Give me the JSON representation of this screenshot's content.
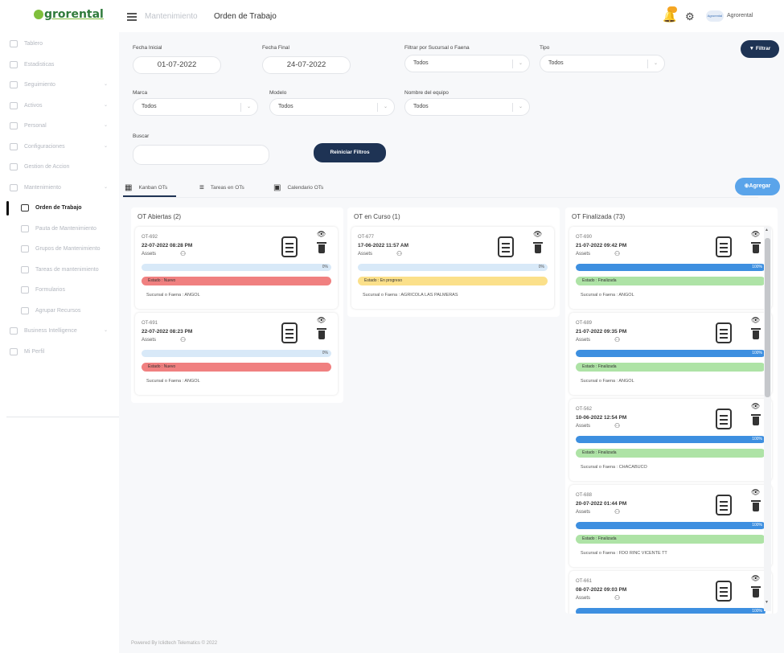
{
  "app": {
    "logo_text": "grorental"
  },
  "sidebar": {
    "items": [
      {
        "label": "Tablero",
        "chevron": false,
        "sub": false,
        "active": false
      },
      {
        "label": "Estadisticas",
        "chevron": false,
        "sub": false,
        "active": false
      },
      {
        "label": "Seguimiento",
        "chevron": true,
        "sub": false,
        "active": false
      },
      {
        "label": "Activos",
        "chevron": true,
        "sub": false,
        "active": false
      },
      {
        "label": "Personal",
        "chevron": true,
        "sub": false,
        "active": false
      },
      {
        "label": "Configuraciones",
        "chevron": true,
        "sub": false,
        "active": false
      },
      {
        "label": "Gestion de Accion",
        "chevron": false,
        "sub": false,
        "active": false
      },
      {
        "label": "Mantenimiento",
        "chevron": true,
        "sub": false,
        "active": false
      },
      {
        "label": "Orden de Trabajo",
        "chevron": false,
        "sub": true,
        "active": true
      },
      {
        "label": "Pauta de Mantenimiento",
        "chevron": false,
        "sub": true,
        "active": false
      },
      {
        "label": "Grupos de Mantenimiento",
        "chevron": false,
        "sub": true,
        "active": false
      },
      {
        "label": "Tareas de mantenimiento",
        "chevron": false,
        "sub": true,
        "active": false
      },
      {
        "label": "Formularios",
        "chevron": false,
        "sub": true,
        "active": false
      },
      {
        "label": "Agrupar Recursos",
        "chevron": false,
        "sub": true,
        "active": false
      },
      {
        "label": "Business Intelligence",
        "chevron": true,
        "sub": false,
        "active": false
      },
      {
        "label": "Mi Perfil",
        "chevron": false,
        "sub": false,
        "active": false
      }
    ]
  },
  "header": {
    "crumb_parent": "Mantenimiento",
    "crumb_current": "Orden de Trabajo",
    "avatar_text": "Agrorental",
    "user_name": "Agrorental"
  },
  "filters": {
    "fecha_inicial_label": "Fecha Inicial",
    "fecha_inicial_value": "01-07-2022",
    "fecha_final_label": "Fecha Final",
    "fecha_final_value": "24-07-2022",
    "sucursal_label": "Filtrar por Sucursal o Faena",
    "sucursal_value": "Todos",
    "tipo_label": "Tipo",
    "tipo_value": "Todos",
    "marca_label": "Marca",
    "marca_value": "Todos",
    "modelo_label": "Modelo",
    "modelo_value": "Todos",
    "equipo_label": "Nombre del equipo",
    "equipo_value": "Todos",
    "buscar_label": "Buscar",
    "buscar_value": "",
    "reset_label": "Reiniciar Filtros",
    "filter_button": "Filtrar"
  },
  "tabs": [
    {
      "label": "Kanban OTs",
      "icon": "kanban-icon"
    },
    {
      "label": "Tareas en OTs",
      "icon": "list-icon"
    },
    {
      "label": "Calendario OTs",
      "icon": "calendar-icon"
    }
  ],
  "add_button": "Agregar",
  "columns": [
    {
      "title": "OT Abiertas (2)",
      "cards": [
        {
          "id": "OT-692",
          "date": "22-07-2022 08:28 PM",
          "assets": "Assets",
          "progress": 0,
          "pct": "0%",
          "status": "Estado : Nuevo",
          "status_color": "#f08080",
          "sucursal": "Sucursal o Faena : ANGOL"
        },
        {
          "id": "OT-691",
          "date": "22-07-2022 08:23 PM",
          "assets": "Assets",
          "progress": 0,
          "pct": "0%",
          "status": "Estado : Nuevo",
          "status_color": "#f08080",
          "sucursal": "Sucursal o Faena : ANGOL"
        }
      ]
    },
    {
      "title": "OT en Curso (1)",
      "cards": [
        {
          "id": "OT-677",
          "date": "17-06-2022 11:57 AM",
          "assets": "Assets",
          "progress": 0,
          "pct": "0%",
          "status": "Estado : En progreso",
          "status_color": "#fbe08a",
          "sucursal": "Sucursal o Faena : AGRICOLA LAS PALMERAS"
        }
      ]
    },
    {
      "title": "OT Finalizada (73)",
      "cards": [
        {
          "id": "OT-690",
          "date": "21-07-2022 09:42 PM",
          "assets": "Assets",
          "progress": 100,
          "pct": "100%",
          "status": "Estado : Finalizada",
          "status_color": "#aee3a6",
          "sucursal": "Sucursal o Faena : ANGOL"
        },
        {
          "id": "OT-689",
          "date": "21-07-2022 09:35 PM",
          "assets": "Assets",
          "progress": 100,
          "pct": "100%",
          "status": "Estado : Finalizada",
          "status_color": "#aee3a6",
          "sucursal": "Sucursal o Faena : ANGOL"
        },
        {
          "id": "OT-562",
          "date": "10-06-2022 12:54 PM",
          "assets": "Assets",
          "progress": 100,
          "pct": "100%",
          "status": "Estado : Finalizada",
          "status_color": "#aee3a6",
          "sucursal": "Sucursal o Faena : CHACABUCO"
        },
        {
          "id": "OT-688",
          "date": "20-07-2022 01:44 PM",
          "assets": "Assets",
          "progress": 100,
          "pct": "100%",
          "status": "Estado : Finalizada",
          "status_color": "#aee3a6",
          "sucursal": "Sucursal o Faena : FDO RINC VICENTE TT"
        },
        {
          "id": "OT-661",
          "date": "08-07-2022 09:03 PM",
          "assets": "Assets",
          "progress": 100,
          "pct": "100%",
          "status": "Estado : Finalizada",
          "status_color": "#aee3a6",
          "sucursal": "Sucursal o Faena : ANGOL"
        }
      ]
    }
  ],
  "footer": "Powered By Iclidtech Telematics © 2022"
}
